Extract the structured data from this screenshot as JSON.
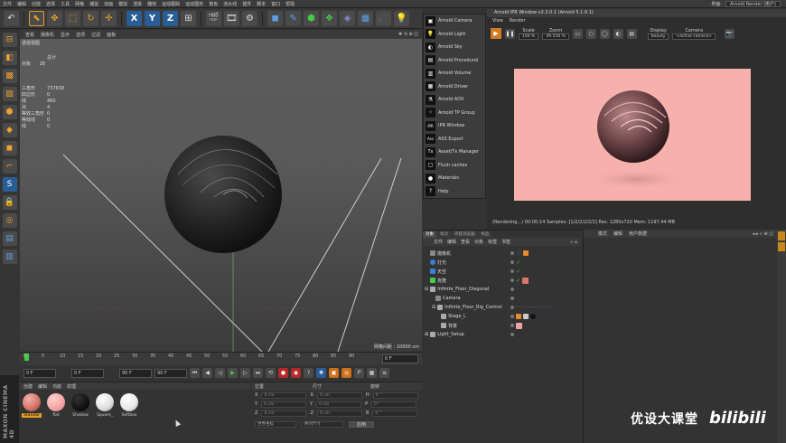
{
  "menubar": {
    "items": [
      "文件",
      "编辑",
      "创建",
      "选择",
      "工具",
      "网格",
      "捕捉",
      "动画",
      "模拟",
      "渲染",
      "雕刻",
      "运动跟踪",
      "运动图形",
      "角色",
      "流水线",
      "插件",
      "脚本",
      "窗口",
      "帮助"
    ],
    "layout_label": "界面:",
    "layout_value": "Arnold Render (用户)"
  },
  "toolbar": {
    "undo_icon": "undo-icon",
    "xyz": [
      "X",
      "Y",
      "Z"
    ]
  },
  "viewport": {
    "menu": [
      "查看",
      "摄像机",
      "显示",
      "选项",
      "过滤",
      "面板"
    ],
    "view_name": "透视视图",
    "stats_header": "总计",
    "stats_objects_label": "对象",
    "stats_objects_value": "28",
    "stats": [
      {
        "label": "三角形",
        "value": "737658"
      },
      {
        "label": "四边形",
        "value": "0"
      },
      {
        "label": "线",
        "value": "460"
      },
      {
        "label": "点",
        "value": "4"
      },
      {
        "label": "等效三角形",
        "value": "0"
      },
      {
        "label": "等效线",
        "value": "0"
      },
      {
        "label": "线",
        "value": "0"
      }
    ],
    "grid_spacing": "网格间距 : 10000 cm"
  },
  "timeline": {
    "ticks": [
      "0",
      "5",
      "10",
      "15",
      "20",
      "25",
      "30",
      "35",
      "40",
      "45",
      "50",
      "55",
      "60",
      "65",
      "70",
      "75",
      "80",
      "85",
      "90"
    ],
    "end_frame": "0 F"
  },
  "transport": {
    "start": "0 F",
    "current": "0 F",
    "end": "90 F",
    "end2": "90 F"
  },
  "material_manager": {
    "menu": [
      "创建",
      "编辑",
      "功能",
      "纹理"
    ],
    "materials": [
      {
        "name": "Standar",
        "color": "#d9776c",
        "selected": true
      },
      {
        "name": "flat",
        "color": "#f4a3a3",
        "selected": false
      },
      {
        "name": "Shadow",
        "color": "#111111",
        "selected": false
      },
      {
        "name": "Square_",
        "color": "#eeeeee",
        "selected": false
      },
      {
        "name": "Softbox",
        "color": "#f2f2f2",
        "selected": false
      }
    ]
  },
  "coordinates": {
    "headers": [
      "位置",
      "尺寸",
      "旋转"
    ],
    "rows": [
      {
        "axis": "X",
        "pos": "0 cm",
        "axis2": "X",
        "size": "0 cm",
        "axis3": "H",
        "rot": "0 °"
      },
      {
        "axis": "Y",
        "pos": "0 cm",
        "axis2": "Y",
        "size": "0 cm",
        "axis3": "P",
        "rot": "0 °"
      },
      {
        "axis": "Z",
        "pos": "0 cm",
        "axis2": "Z",
        "size": "0 cm",
        "axis3": "B",
        "rot": "0 °"
      }
    ],
    "mode1": "世界坐标",
    "mode2": "绝对尺寸",
    "apply": "应用"
  },
  "arnold_menu": {
    "items": [
      {
        "icon": "▣",
        "label": "Arnold Camera"
      },
      {
        "icon": "💡",
        "label": "Arnold Light"
      },
      {
        "icon": "◐",
        "label": "Arnold Sky"
      },
      {
        "icon": "▤",
        "label": "Arnold Procedural"
      },
      {
        "icon": "▥",
        "label": "Arnold Volume"
      },
      {
        "icon": "▦",
        "label": "Arnold Driver"
      },
      {
        "icon": "⚗",
        "label": "Arnold AOV"
      },
      {
        "icon": "⁘",
        "label": "Arnold TP Group"
      },
      {
        "icon": "IPR",
        "label": "IPR Window"
      },
      {
        "icon": "Ass",
        "label": "ASS Export"
      },
      {
        "icon": "Tx",
        "label": "Asset/Tx Manager"
      },
      {
        "icon": "▢",
        "label": "Flush caches"
      },
      {
        "icon": "●",
        "label": "Materials"
      },
      {
        "icon": "?",
        "label": "Help"
      }
    ]
  },
  "ipr": {
    "title": "Arnold IPR Window v2.3.0.1 (Arnold 5.1.0.1)",
    "menu": [
      "View",
      "Render"
    ],
    "scale_label": "Scale",
    "scale_value": "100 %",
    "zoom_label": "Zoom",
    "zoom_value": "39.518 %",
    "display_label": "Display",
    "display_value": "beauty",
    "camera_label": "Camera",
    "camera_value": "<active camera>",
    "status": "(Rendering...) 00:00:14  Samples: [1/2/2/2/2/2]  Res: 1280x720  Mem: 1197.44 MB",
    "bg_color": "#f6b1ad"
  },
  "object_manager": {
    "tabs": [
      "对象",
      "场次",
      "内容浏览器",
      "构造"
    ],
    "menu": [
      "文件",
      "编辑",
      "查看",
      "对象",
      "标签",
      "书签"
    ],
    "rows": [
      {
        "name": "摄像机",
        "indent": 0,
        "color": "#888",
        "tags": [
          "camera"
        ]
      },
      {
        "name": "灯光",
        "indent": 0,
        "color": "#3a7fd0",
        "tags": [
          "check"
        ]
      },
      {
        "name": "天空",
        "indent": 0,
        "color": "#3a7fd0",
        "tags": [
          "check"
        ]
      },
      {
        "name": "克隆",
        "indent": 0,
        "color": "#4c4",
        "tags": [
          "check",
          "mat"
        ]
      },
      {
        "name": "Infinite_Floor_Diagonal",
        "indent": 0,
        "color": "#aaa",
        "tags": []
      },
      {
        "name": "Camera",
        "indent": 1,
        "color": "#888",
        "tags": []
      },
      {
        "name": "Infinite_Floor_Rig_Control",
        "indent": 1,
        "color": "#aaa",
        "tags": [
          "dots"
        ]
      },
      {
        "name": "Stage_L",
        "indent": 2,
        "color": "#aaa",
        "tags": [
          "mats"
        ]
      },
      {
        "name": "背景",
        "indent": 2,
        "color": "#aaa",
        "tags": [
          "mat"
        ]
      },
      {
        "name": "Light_Setup",
        "indent": 0,
        "color": "#aaa",
        "tags": []
      }
    ]
  },
  "attributes": {
    "menu": [
      "模式",
      "编辑",
      "用户数据"
    ]
  },
  "watermark": {
    "text": "优设大课堂",
    "logo": "bilibili"
  }
}
